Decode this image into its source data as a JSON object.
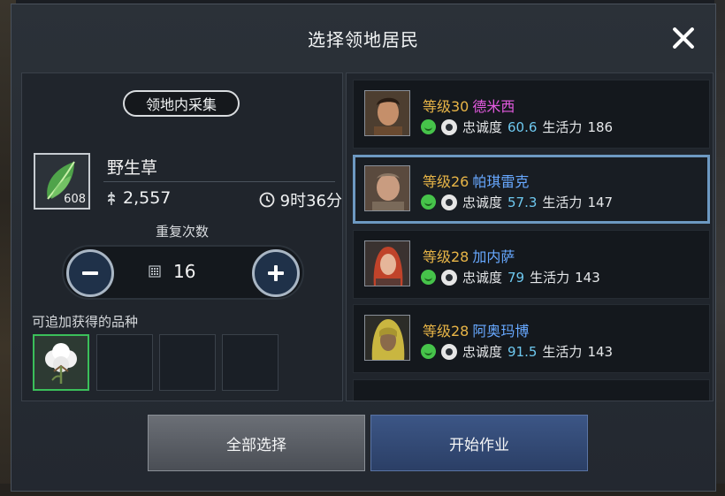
{
  "dialog": {
    "title": "选择领地居民"
  },
  "gathering": {
    "section_label": "领地内采集",
    "item": {
      "name": "野生草",
      "count": "608",
      "amount": "2,557",
      "time": "9时36分",
      "icon": "leaf-icon"
    },
    "repeat_label": "重复次数",
    "repeat_value": "16",
    "extra_label": "可追加获得的品种",
    "extra_items": [
      "cotton-icon",
      "",
      "",
      ""
    ]
  },
  "workers": [
    {
      "level": "等级30",
      "name": "德米西",
      "name_color": "#e45ae0",
      "loyalty_label": "忠诚度",
      "loyalty": "60.6",
      "stamina_label": "生活力",
      "stamina": "186",
      "selected": false
    },
    {
      "level": "等级26",
      "name": "帕琪雷克",
      "name_color": "#67a8ff",
      "loyalty_label": "忠诚度",
      "loyalty": "57.3",
      "stamina_label": "生活力",
      "stamina": "147",
      "selected": true
    },
    {
      "level": "等级28",
      "name": "加内萨",
      "name_color": "#67a8ff",
      "loyalty_label": "忠诚度",
      "loyalty": "79",
      "stamina_label": "生活力",
      "stamina": "143",
      "selected": false
    },
    {
      "level": "等级28",
      "name": "阿奥玛博",
      "name_color": "#67a8ff",
      "loyalty_label": "忠诚度",
      "loyalty": "91.5",
      "stamina_label": "生活力",
      "stamina": "143",
      "selected": false
    }
  ],
  "actions": {
    "select_all": "全部选择",
    "start": "开始作业"
  },
  "colors": {
    "level": "#e8b547",
    "value": "#6ec9f0",
    "selected_border": "#6d99c2"
  }
}
